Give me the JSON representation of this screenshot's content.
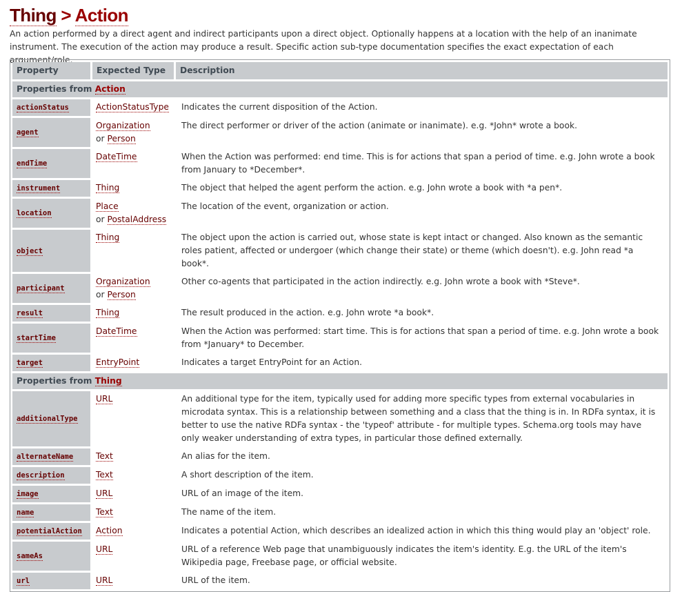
{
  "header": {
    "crumbs": [
      "Thing",
      "Action"
    ],
    "separator": ">",
    "intro": "An action performed by a direct agent and indirect participants upon a direct object. Optionally happens at a location with the help of an inanimate instrument. The execution of the action may produce a result. Specific action sub-type documentation specifies the exact expectation of each argument/role."
  },
  "table": {
    "columns": [
      "Property",
      "Expected Type",
      "Description"
    ],
    "or_word": "or",
    "sections": [
      {
        "prefix": "Properties from",
        "type": "Action",
        "rows": [
          {
            "property": "actionStatus",
            "types": [
              "ActionStatusType"
            ],
            "description": "Indicates the current disposition of the Action."
          },
          {
            "property": "agent",
            "types": [
              "Organization",
              "Person"
            ],
            "description": "The direct performer or driver of the action (animate or inanimate). e.g. *John* wrote a book."
          },
          {
            "property": "endTime",
            "types": [
              "DateTime"
            ],
            "description": "When the Action was performed: end time. This is for actions that span a period of time. e.g. John wrote a book from January to *December*."
          },
          {
            "property": "instrument",
            "types": [
              "Thing"
            ],
            "description": "The object that helped the agent perform the action. e.g. John wrote a book with *a pen*."
          },
          {
            "property": "location",
            "types": [
              "Place",
              "PostalAddress"
            ],
            "description": "The location of the event, organization or action."
          },
          {
            "property": "object",
            "types": [
              "Thing"
            ],
            "description": "The object upon the action is carried out, whose state is kept intact or changed. Also known as the semantic roles patient, affected or undergoer (which change their state) or theme (which doesn't). e.g. John read *a book*."
          },
          {
            "property": "participant",
            "types": [
              "Organization",
              "Person"
            ],
            "description": "Other co-agents that participated in the action indirectly. e.g. John wrote a book with *Steve*."
          },
          {
            "property": "result",
            "types": [
              "Thing"
            ],
            "description": "The result produced in the action. e.g. John wrote *a book*."
          },
          {
            "property": "startTime",
            "types": [
              "DateTime"
            ],
            "description": "When the Action was performed: start time. This is for actions that span a period of time. e.g. John wrote a book from *January* to December."
          },
          {
            "property": "target",
            "types": [
              "EntryPoint"
            ],
            "description": "Indicates a target EntryPoint for an Action."
          }
        ]
      },
      {
        "prefix": "Properties from",
        "type": "Thing",
        "rows": [
          {
            "property": "additionalType",
            "types": [
              "URL"
            ],
            "description": "An additional type for the item, typically used for adding more specific types from external vocabularies in microdata syntax. This is a relationship between something and a class that the thing is in. In RDFa syntax, it is better to use the native RDFa syntax - the 'typeof' attribute - for multiple types. Schema.org tools may have only weaker understanding of extra types, in particular those defined externally."
          },
          {
            "property": "alternateName",
            "types": [
              "Text"
            ],
            "description": "An alias for the item."
          },
          {
            "property": "description",
            "types": [
              "Text"
            ],
            "description": "A short description of the item."
          },
          {
            "property": "image",
            "types": [
              "URL"
            ],
            "description": "URL of an image of the item."
          },
          {
            "property": "name",
            "types": [
              "Text"
            ],
            "description": "The name of the item."
          },
          {
            "property": "potentialAction",
            "types": [
              "Action"
            ],
            "description": "Indicates a potential Action, which describes an idealized action in which this thing would play an 'object' role."
          },
          {
            "property": "sameAs",
            "types": [
              "URL"
            ],
            "description": "URL of a reference Web page that unambiguously indicates the item's identity. E.g. the URL of the item's Wikipedia page, Freebase page, or official website."
          },
          {
            "property": "url",
            "types": [
              "URL"
            ],
            "description": "URL of the item."
          }
        ]
      }
    ]
  }
}
